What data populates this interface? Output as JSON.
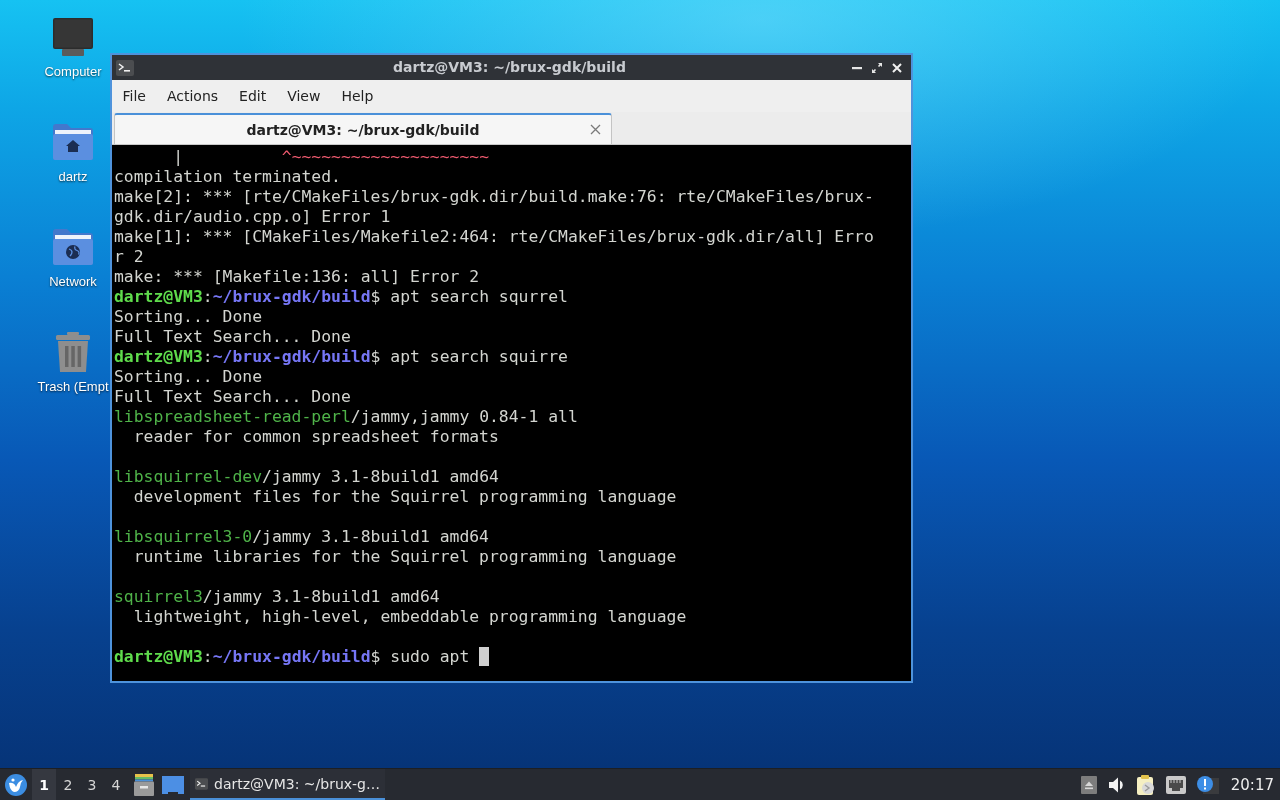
{
  "desktop": {
    "icons": [
      {
        "kind": "computer",
        "label": "Computer"
      },
      {
        "kind": "home_folder",
        "label": "dartz"
      },
      {
        "kind": "network_folder",
        "label": "Network"
      },
      {
        "kind": "trash",
        "label": "Trash (Empt"
      }
    ]
  },
  "window": {
    "title": "dartz@VM3: ~/brux-gdk/build",
    "menu": [
      "File",
      "Actions",
      "Edit",
      "View",
      "Help"
    ],
    "tabs": [
      {
        "label": "dartz@VM3: ~/brux-gdk/build",
        "selected": true
      }
    ],
    "terminal": {
      "cursor_visible": true,
      "lines": [
        {
          "kind": "text",
          "parts": [
            {
              "kind": "plain",
              "text": "      |          "
            },
            {
              "kind": "error",
              "text": "^~~~~~~~~~~~~~~~~~~~~"
            }
          ]
        },
        {
          "kind": "text",
          "parts": [
            {
              "kind": "plain",
              "text": "compilation terminated."
            }
          ]
        },
        {
          "kind": "text",
          "parts": [
            {
              "kind": "plain",
              "text": "make[2]: *** [rte/CMakeFiles/brux-gdk.dir/build.make:76: rte/CMakeFiles/brux-"
            }
          ]
        },
        {
          "kind": "text",
          "parts": [
            {
              "kind": "plain",
              "text": "gdk.dir/audio.cpp.o] Error 1"
            }
          ]
        },
        {
          "kind": "text",
          "parts": [
            {
              "kind": "plain",
              "text": "make[1]: *** [CMakeFiles/Makefile2:464: rte/CMakeFiles/brux-gdk.dir/all] Erro"
            }
          ]
        },
        {
          "kind": "text",
          "parts": [
            {
              "kind": "plain",
              "text": "r 2"
            }
          ]
        },
        {
          "kind": "text",
          "parts": [
            {
              "kind": "plain",
              "text": "make: *** [Makefile:136: all] Error 2"
            }
          ]
        },
        {
          "kind": "text",
          "parts": [
            {
              "kind": "user",
              "text": "dartz@VM3"
            },
            {
              "kind": "plain",
              "text": ":"
            },
            {
              "kind": "path",
              "text": "~/brux-gdk/build"
            },
            {
              "kind": "plain",
              "text": "$ apt search squrrel"
            }
          ]
        },
        {
          "kind": "text",
          "parts": [
            {
              "kind": "plain",
              "text": "Sorting... Done"
            }
          ]
        },
        {
          "kind": "text",
          "parts": [
            {
              "kind": "plain",
              "text": "Full Text Search... Done"
            }
          ]
        },
        {
          "kind": "text",
          "parts": [
            {
              "kind": "user",
              "text": "dartz@VM3"
            },
            {
              "kind": "plain",
              "text": ":"
            },
            {
              "kind": "path",
              "text": "~/brux-gdk/build"
            },
            {
              "kind": "plain",
              "text": "$ apt search squirre"
            }
          ]
        },
        {
          "kind": "text",
          "parts": [
            {
              "kind": "plain",
              "text": "Sorting... Done"
            }
          ]
        },
        {
          "kind": "text",
          "parts": [
            {
              "kind": "plain",
              "text": "Full Text Search... Done"
            }
          ]
        },
        {
          "kind": "text",
          "parts": [
            {
              "kind": "package",
              "text": "libspreadsheet-read-perl"
            },
            {
              "kind": "plain",
              "text": "/jammy,jammy 0.84-1 all"
            }
          ]
        },
        {
          "kind": "text",
          "parts": [
            {
              "kind": "plain",
              "text": "  reader for common spreadsheet formats"
            }
          ]
        },
        {
          "kind": "blank"
        },
        {
          "kind": "text",
          "parts": [
            {
              "kind": "package",
              "text": "libsquirrel-dev"
            },
            {
              "kind": "plain",
              "text": "/jammy 3.1-8build1 amd64"
            }
          ]
        },
        {
          "kind": "text",
          "parts": [
            {
              "kind": "plain",
              "text": "  development files for the Squirrel programming language"
            }
          ]
        },
        {
          "kind": "blank"
        },
        {
          "kind": "text",
          "parts": [
            {
              "kind": "package",
              "text": "libsquirrel3-0"
            },
            {
              "kind": "plain",
              "text": "/jammy 3.1-8build1 amd64"
            }
          ]
        },
        {
          "kind": "text",
          "parts": [
            {
              "kind": "plain",
              "text": "  runtime libraries for the Squirrel programming language"
            }
          ]
        },
        {
          "kind": "blank"
        },
        {
          "kind": "text",
          "parts": [
            {
              "kind": "package",
              "text": "squirrel3"
            },
            {
              "kind": "plain",
              "text": "/jammy 3.1-8build1 amd64"
            }
          ]
        },
        {
          "kind": "text",
          "parts": [
            {
              "kind": "plain",
              "text": "  lightweight, high-level, embeddable programming language"
            }
          ]
        },
        {
          "kind": "blank"
        },
        {
          "kind": "text",
          "parts": [
            {
              "kind": "user",
              "text": "dartz@VM3"
            },
            {
              "kind": "plain",
              "text": ":"
            },
            {
              "kind": "path",
              "text": "~/brux-gdk/build"
            },
            {
              "kind": "plain",
              "text": "$ sudo apt "
            }
          ]
        }
      ]
    }
  },
  "taskbar": {
    "workspaces": [
      {
        "label": "1",
        "selected": true
      },
      {
        "label": "2",
        "selected": false
      },
      {
        "label": "3",
        "selected": false
      },
      {
        "label": "4",
        "selected": false
      }
    ],
    "launchers": [
      {
        "kind": "file_drawer"
      },
      {
        "kind": "screen"
      }
    ],
    "tasks": [
      {
        "label": "dartz@VM3: ~/brux-g…",
        "selected": true
      }
    ],
    "tray": [
      {
        "kind": "eject"
      },
      {
        "kind": "volume"
      },
      {
        "kind": "clipboard"
      },
      {
        "kind": "network"
      },
      {
        "kind": "alert"
      }
    ],
    "clock": "20:17"
  }
}
